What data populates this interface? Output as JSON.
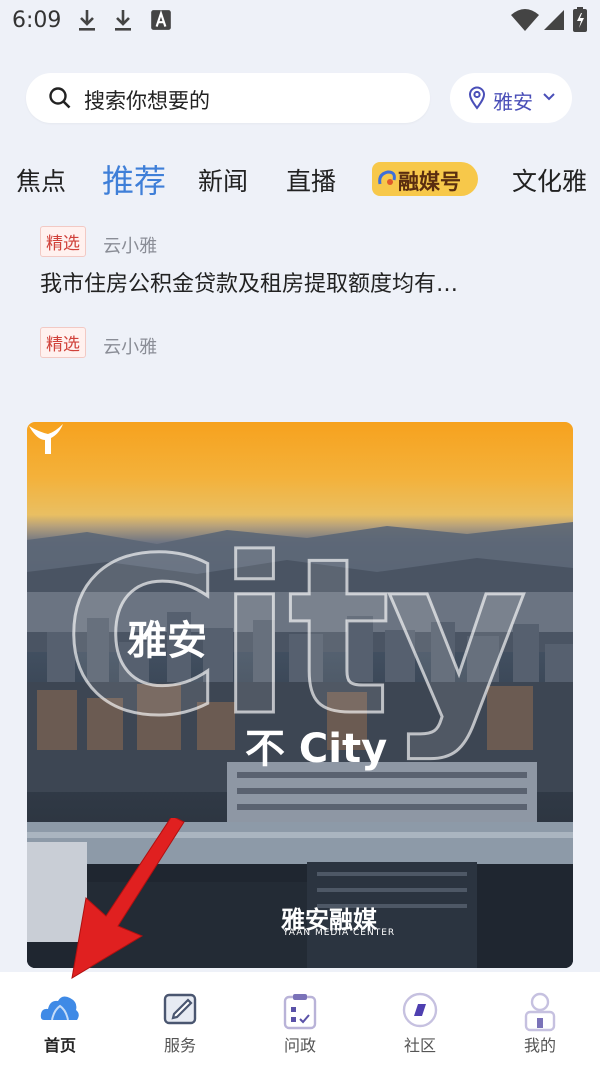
{
  "status_bar": {
    "time": "6:09",
    "icons": [
      "download-icon",
      "download-icon",
      "font-a-icon",
      "wifi-icon",
      "signal-icon",
      "battery-icon"
    ]
  },
  "search": {
    "placeholder": "搜索你想要的"
  },
  "location": {
    "label": "雅安"
  },
  "tabs": [
    {
      "label": "焦点"
    },
    {
      "label": "推荐",
      "active": true
    },
    {
      "label": "新闻"
    },
    {
      "label": "直播"
    },
    {
      "label": "融媒号",
      "badge": true
    },
    {
      "label": "文化雅"
    }
  ],
  "feed": [
    {
      "tag": "精选",
      "source": "云小雅",
      "headline": "我市住房公积金贷款及租房提取额度均有…"
    },
    {
      "tag": "精选",
      "source": "云小雅"
    }
  ],
  "banner": {
    "big_text": "City",
    "city_name": "雅安",
    "subtitle": "不 City",
    "logo_text": "雅安融媒",
    "logo_sub": "YAAN MEDIA CENTER"
  },
  "bottom_nav": [
    {
      "label": "首页",
      "icon": "home-cloud-icon",
      "active": true
    },
    {
      "label": "服务",
      "icon": "edit-icon"
    },
    {
      "label": "问政",
      "icon": "clipboard-icon"
    },
    {
      "label": "社区",
      "icon": "compass-icon"
    },
    {
      "label": "我的",
      "icon": "user-icon"
    }
  ],
  "colors": {
    "accent": "#3f7fd8",
    "location_text": "#4a4fb8",
    "tag_red": "#d0413a",
    "badge_yellow": "#f7c84a",
    "arrow": "#e02020"
  }
}
